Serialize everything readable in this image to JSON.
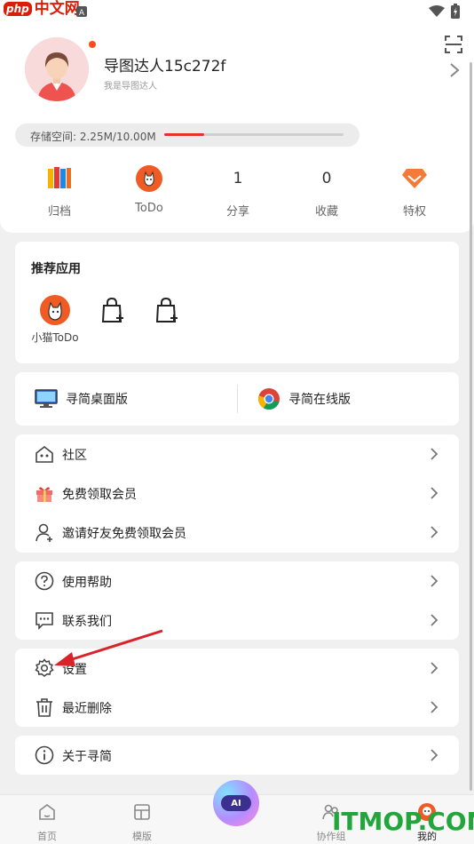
{
  "status": {
    "watermark_brand": "php",
    "watermark_site": "中文网"
  },
  "profile": {
    "username": "导图达人15c272f",
    "bio": "我是导图达人"
  },
  "storage": {
    "label": "存储空间:  2.25M/10.00M",
    "used_fraction": 0.225
  },
  "stats": [
    {
      "label": "归档",
      "icon": "archive-books-icon"
    },
    {
      "label": "ToDo",
      "icon": "todo-cat-icon"
    },
    {
      "label": "分享",
      "value": "1"
    },
    {
      "label": "收藏",
      "value": "0"
    },
    {
      "label": "特权",
      "icon": "diamond-icon"
    }
  ],
  "recommended": {
    "title": "推荐应用",
    "apps": [
      {
        "label": "小猫ToDo",
        "icon": "cat-todo-app-icon"
      },
      {
        "label": "",
        "icon": "add-app-bag-icon"
      },
      {
        "label": "",
        "icon": "add-app-bag-icon"
      }
    ]
  },
  "versions": {
    "desktop": "寻简桌面版",
    "online": "寻简在线版"
  },
  "menu_group1": [
    {
      "label": "社区",
      "icon": "community-house-icon"
    },
    {
      "label": "免费领取会员",
      "icon": "gift-icon"
    },
    {
      "label": "邀请好友免费领取会员",
      "icon": "invite-user-icon"
    }
  ],
  "menu_group2": [
    {
      "label": "使用帮助",
      "icon": "help-icon"
    },
    {
      "label": "联系我们",
      "icon": "chat-icon"
    }
  ],
  "menu_group3": [
    {
      "label": "设置",
      "icon": "gear-icon"
    },
    {
      "label": "最近删除",
      "icon": "trash-icon"
    }
  ],
  "menu_group4": [
    {
      "label": "关于寻简",
      "icon": "info-icon"
    }
  ],
  "tabs": [
    {
      "label": "首页",
      "icon": "home-icon"
    },
    {
      "label": "模版",
      "icon": "template-icon"
    },
    {
      "label": "AI",
      "icon": "ai-orb-icon"
    },
    {
      "label": "协作组",
      "icon": "collab-icon"
    },
    {
      "label": "我的",
      "icon": "me-icon"
    }
  ],
  "watermark_bottom": "ITMOP.COM",
  "colors": {
    "accent_red": "#e5322d",
    "orange": "#f05a23",
    "watermark_green": "#22a63b"
  }
}
